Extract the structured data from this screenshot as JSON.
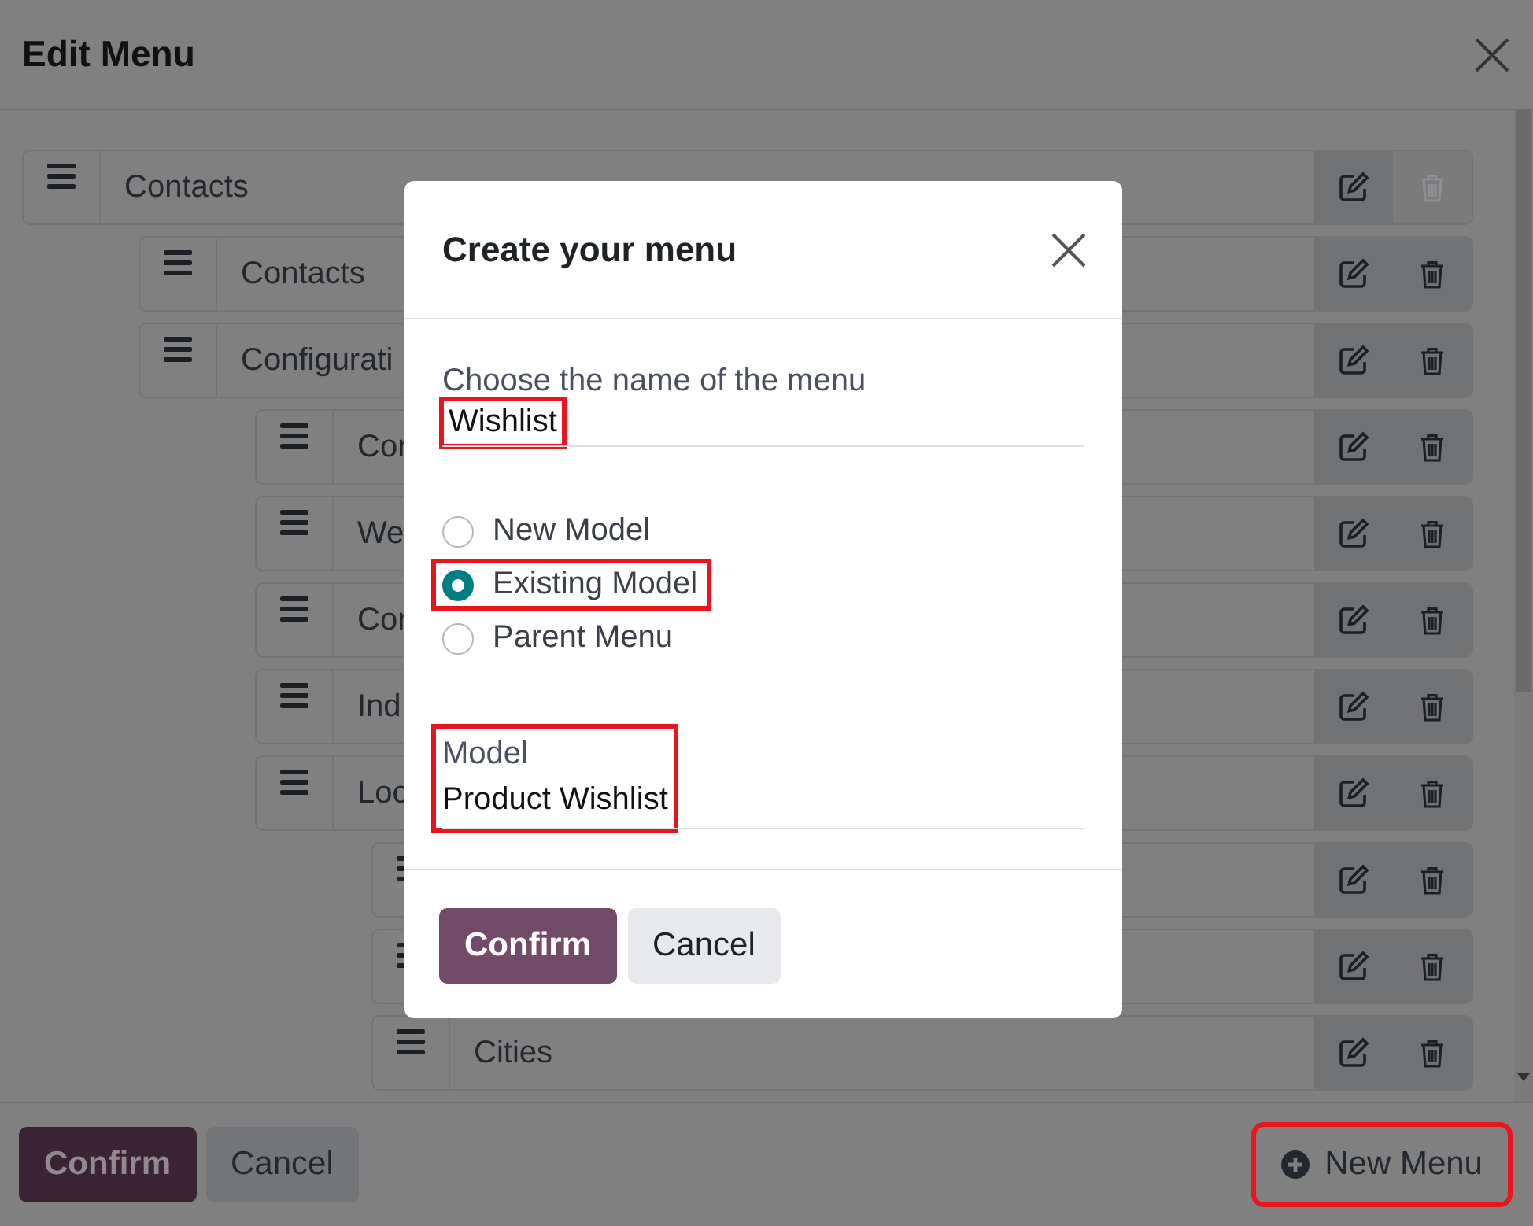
{
  "window": {
    "title": "Edit Menu"
  },
  "menu_tree": [
    {
      "label": "Contacts",
      "delete_disabled": true,
      "children": [
        {
          "label": "Contacts",
          "delete_disabled": false
        },
        {
          "label": "Configurati",
          "delete_disabled": false,
          "children": [
            {
              "label": "Cor",
              "delete_disabled": false
            },
            {
              "label": "We",
              "delete_disabled": false
            },
            {
              "label": "Cor",
              "delete_disabled": false
            },
            {
              "label": "Ind",
              "delete_disabled": false
            },
            {
              "label": "Loc",
              "delete_disabled": false,
              "children": [
                {
                  "delete_disabled": false
                },
                {
                  "delete_disabled": false
                },
                {
                  "label": "Cities",
                  "delete_disabled": false
                }
              ]
            }
          ]
        }
      ]
    }
  ],
  "footer": {
    "confirm": "Confirm",
    "cancel": "Cancel",
    "new_menu": {
      "label": "New Menu",
      "highlighted": true
    }
  },
  "dialog": {
    "title": "Create your menu",
    "name_field": {
      "label": "Choose the name of the menu",
      "value": "Wishlist",
      "highlighted": true
    },
    "options": [
      {
        "label": "New Model",
        "selected": false,
        "highlighted": false
      },
      {
        "label": "Existing Model",
        "selected": true,
        "highlighted": true
      },
      {
        "label": "Parent Menu",
        "selected": false,
        "highlighted": false
      }
    ],
    "model_field": {
      "label": "Model",
      "value": "Product Wishlist",
      "highlighted": true
    },
    "buttons": {
      "confirm": "Confirm",
      "cancel": "Cancel"
    }
  }
}
